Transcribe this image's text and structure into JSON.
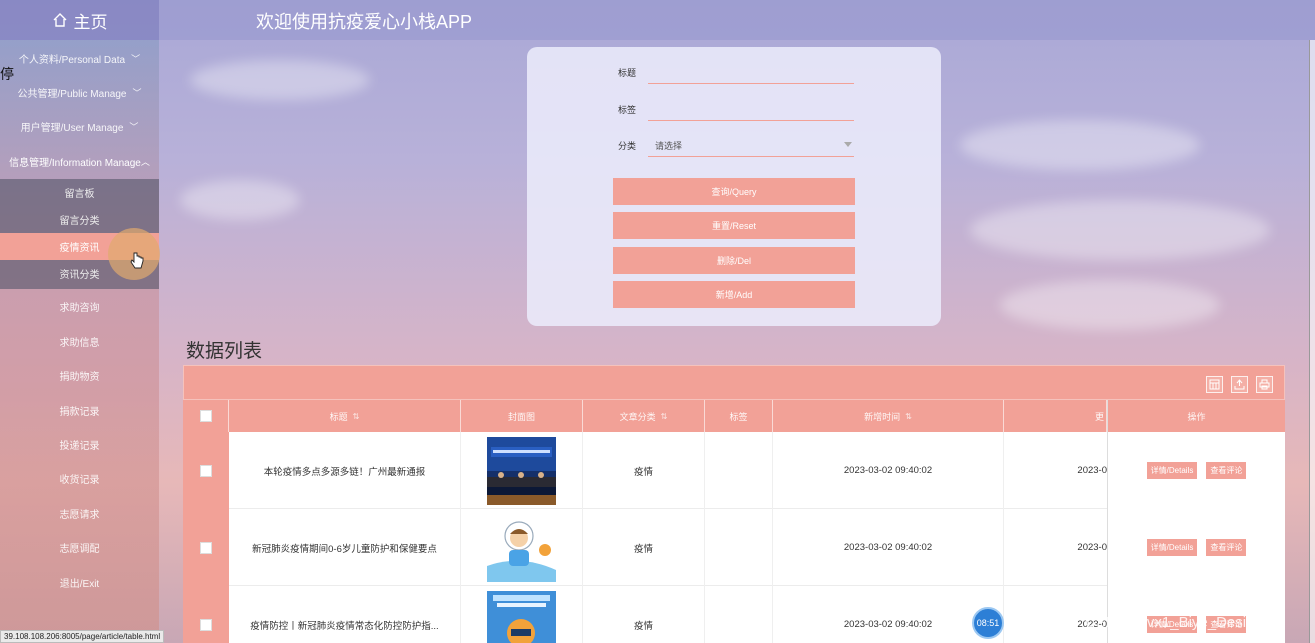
{
  "topbar": {
    "home_label": "主页",
    "app_title": "欢迎使用抗疫爱心小栈APP"
  },
  "sidebar": {
    "edge_text": "停",
    "groups": [
      {
        "label": "个人资料/Personal Data",
        "chevron": "﹀"
      },
      {
        "label": "公共管理/Public Manage",
        "chevron": "﹀"
      },
      {
        "label": "用户管理/User Manage",
        "chevron": "﹀"
      },
      {
        "label": "信息管理/Information Manage",
        "chevron": "︿"
      }
    ],
    "sub_items": [
      "留言板",
      "留言分类",
      "疫情资讯",
      "资讯分类"
    ],
    "items": [
      "求助咨询",
      "求助信息",
      "捐助物资",
      "捐款记录",
      "投递记录",
      "收货记录",
      "志愿请求",
      "志愿调配",
      "退出/Exit"
    ]
  },
  "search": {
    "title_label": "标题",
    "tag_label": "标签",
    "category_label": "分类",
    "category_placeholder": "请选择",
    "buttons": {
      "query": "查询/Query",
      "reset": "重置/Reset",
      "del": "删除/Del",
      "add": "新增/Add"
    }
  },
  "list": {
    "title": "数据列表",
    "columns": {
      "title": "标题",
      "cover": "封面图",
      "category": "文章分类",
      "tag": "标签",
      "created": "新增时间",
      "updated": "更",
      "ops": "操作"
    },
    "rows": [
      {
        "title": "本轮疫情多点多源多链！广州最新通报",
        "category": "疫情",
        "tag": "",
        "created": "2023-03-02 09:40:02",
        "updated": "2023-0"
      },
      {
        "title": "新冠肺炎疫情期间0-6岁儿童防护和保健要点",
        "category": "疫情",
        "tag": "",
        "created": "2023-03-02 09:40:02",
        "updated": "2023-0"
      },
      {
        "title": "疫情防控丨新冠肺炎疫情常态化防控防护指...",
        "category": "疫情",
        "tag": "",
        "created": "2023-03-02 09:40:02",
        "updated": "2023-0"
      }
    ],
    "row_buttons": {
      "details": "详情/Details",
      "comments": "查看评论"
    }
  },
  "clock": "08:51",
  "status_url": "39.108.108.206:8005/page/article/table.html",
  "watermark": "CSDN @vx1_Biye_Design",
  "colors": {
    "accent": "#f2a197",
    "topbar": "#9696cd"
  }
}
